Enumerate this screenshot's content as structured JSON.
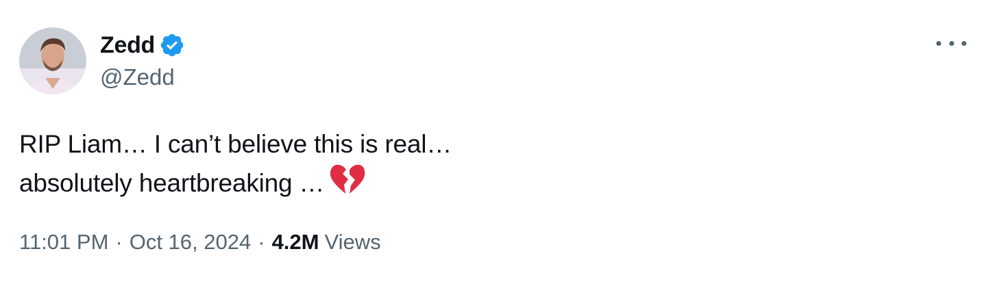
{
  "author": {
    "display_name": "Zedd",
    "handle": "@Zedd",
    "verified": true,
    "verified_color": "#1d9bf0",
    "avatar_icon": "profile-photo"
  },
  "tweet": {
    "text_lines": [
      "RIP Liam… I can’t believe this is real…",
      "absolutely heartbreaking …"
    ],
    "emoji": "broken-heart",
    "emoji_color": "#dd2e44"
  },
  "meta": {
    "time": "11:01 PM",
    "separator": "·",
    "date": "Oct 16, 2024",
    "views_count": "4.2M",
    "views_label": "Views"
  },
  "colors": {
    "primary_text": "#0f1419",
    "secondary_text": "#536471",
    "background": "#ffffff"
  }
}
